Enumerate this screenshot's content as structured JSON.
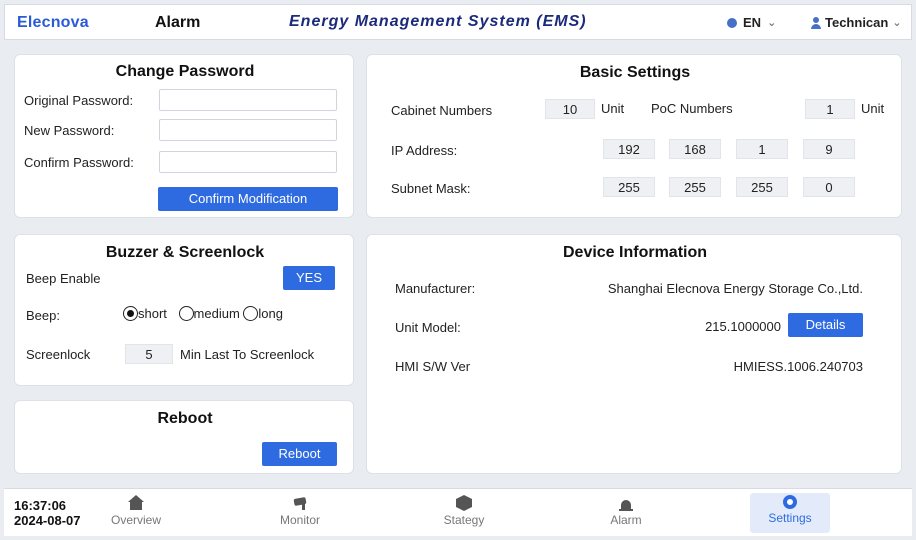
{
  "header": {
    "logo": "Elecnova",
    "alarm": "Alarm",
    "title": "Energy Management System (EMS)",
    "language": "EN",
    "user": "Technican"
  },
  "password": {
    "title": "Change Password",
    "original_label": "Original Password:",
    "new_label": "New Password:",
    "confirm_label": "Confirm Password:",
    "original_value": "",
    "new_value": "",
    "confirm_value": "",
    "confirm_button": "Confirm Modification"
  },
  "buzzer": {
    "title": "Buzzer & Screenlock",
    "beep_enable_label": "Beep Enable",
    "beep_enable_value": "YES",
    "beep_label": "Beep:",
    "options": [
      "short",
      "medium",
      "long"
    ],
    "selected": "short",
    "screenlock_label": "Screenlock",
    "screenlock_value": "5",
    "screenlock_suffix": "Min Last To Screenlock"
  },
  "reboot": {
    "title": "Reboot",
    "button": "Reboot"
  },
  "basic": {
    "title": "Basic Settings",
    "cabinet_label": "Cabinet Numbers",
    "cabinet_value": "10",
    "cabinet_unit": "Unit",
    "poc_label": "PoC Numbers",
    "poc_value": "1",
    "poc_unit": "Unit",
    "ip_label": "IP Address:",
    "ip": [
      "192",
      "168",
      "1",
      "9"
    ],
    "mask_label": "Subnet Mask:",
    "mask": [
      "255",
      "255",
      "255",
      "0"
    ]
  },
  "device": {
    "title": "Device Information",
    "manufacturer_label": "Manufacturer:",
    "manufacturer_value": "Shanghai Elecnova Energy Storage Co.,Ltd.",
    "model_label": "Unit Model:",
    "model_value": "215.1000000",
    "details_button": "Details",
    "hmi_label": "HMI S/W Ver",
    "hmi_value": "HMIESS.1006.240703"
  },
  "footer": {
    "time": "16:37:06",
    "date": "2024-08-07",
    "nav": [
      {
        "label": "Overview",
        "icon": "home-icon"
      },
      {
        "label": "Monitor",
        "icon": "camera-icon"
      },
      {
        "label": "Stategy",
        "icon": "hexagon-icon"
      },
      {
        "label": "Alarm",
        "icon": "alarm-light-icon"
      },
      {
        "label": "Settings",
        "icon": "gear-icon",
        "active": true
      }
    ]
  },
  "colors": {
    "accent": "#2f6be0",
    "title_navy": "#1b2a7a",
    "background": "#e9ecf1"
  }
}
